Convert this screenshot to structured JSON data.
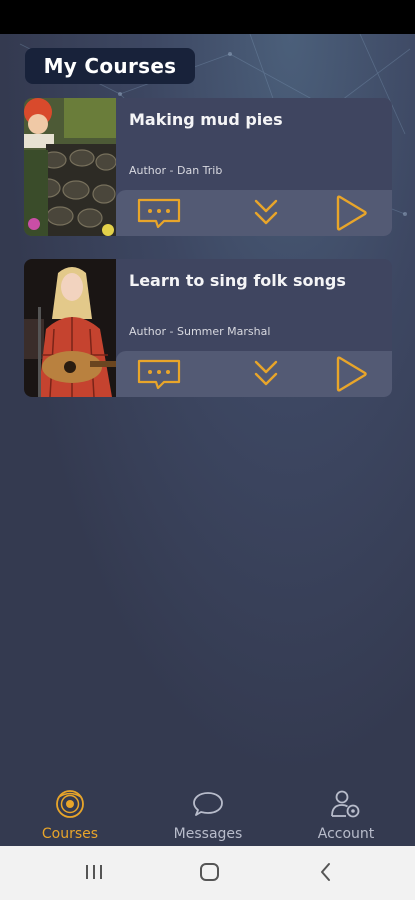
{
  "header": {
    "title": "My Courses"
  },
  "courses": [
    {
      "title": "Making mud pies",
      "author": "Author - Dan Trib"
    },
    {
      "title": "Learn to sing folk songs",
      "author": "Author - Summer Marshal"
    }
  ],
  "actions": {
    "icons": [
      "chat-icon",
      "double-chevron-down-icon",
      "play-icon"
    ]
  },
  "tabs": [
    {
      "label": "Courses",
      "icon": "courses-icon",
      "active": true
    },
    {
      "label": "Messages",
      "icon": "chat-bubble-icon",
      "active": false
    },
    {
      "label": "Account",
      "icon": "user-settings-icon",
      "active": false
    }
  ],
  "system_nav": {
    "icons": [
      "recent-apps-icon",
      "home-icon",
      "back-icon"
    ]
  },
  "colors": {
    "accent": "#e8a52a",
    "background": "#343a50",
    "card": "#3f4560",
    "title_bg": "#18223a"
  }
}
